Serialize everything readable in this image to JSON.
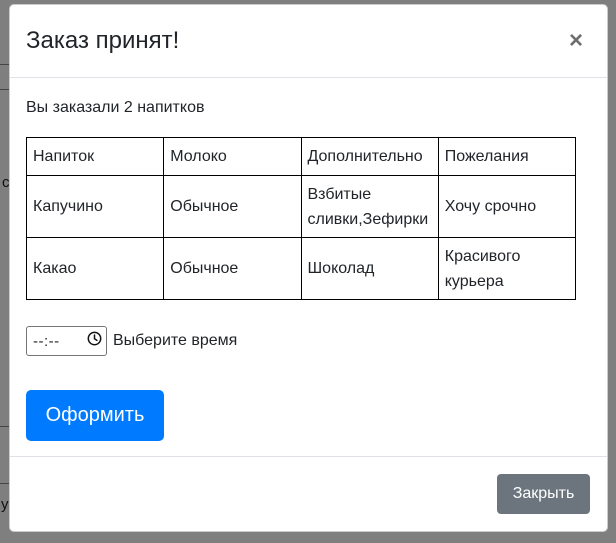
{
  "modal": {
    "title": "Заказ принят!",
    "close_symbol": "×"
  },
  "order": {
    "summary": "Вы заказали 2 напитков",
    "columns": [
      "Напиток",
      "Молоко",
      "Дополнительно",
      "Пожелания"
    ],
    "rows": [
      [
        "Капучино",
        "Обычное",
        "Взбитые сливки,Зефирки",
        "Хочу срочно"
      ],
      [
        "Какао",
        "Обычное",
        "Шоколад",
        "Красивого курьера"
      ]
    ]
  },
  "time": {
    "value": "--:--",
    "icon": "clock-icon",
    "label": "Выберите время"
  },
  "actions": {
    "submit_label": "Оформить",
    "close_label": "Закрыть"
  },
  "background": {
    "letters": [
      "с",
      "у"
    ]
  },
  "colors": {
    "primary": "#007bff",
    "secondary": "#6c757d",
    "backdrop": "#7a7a7a"
  }
}
